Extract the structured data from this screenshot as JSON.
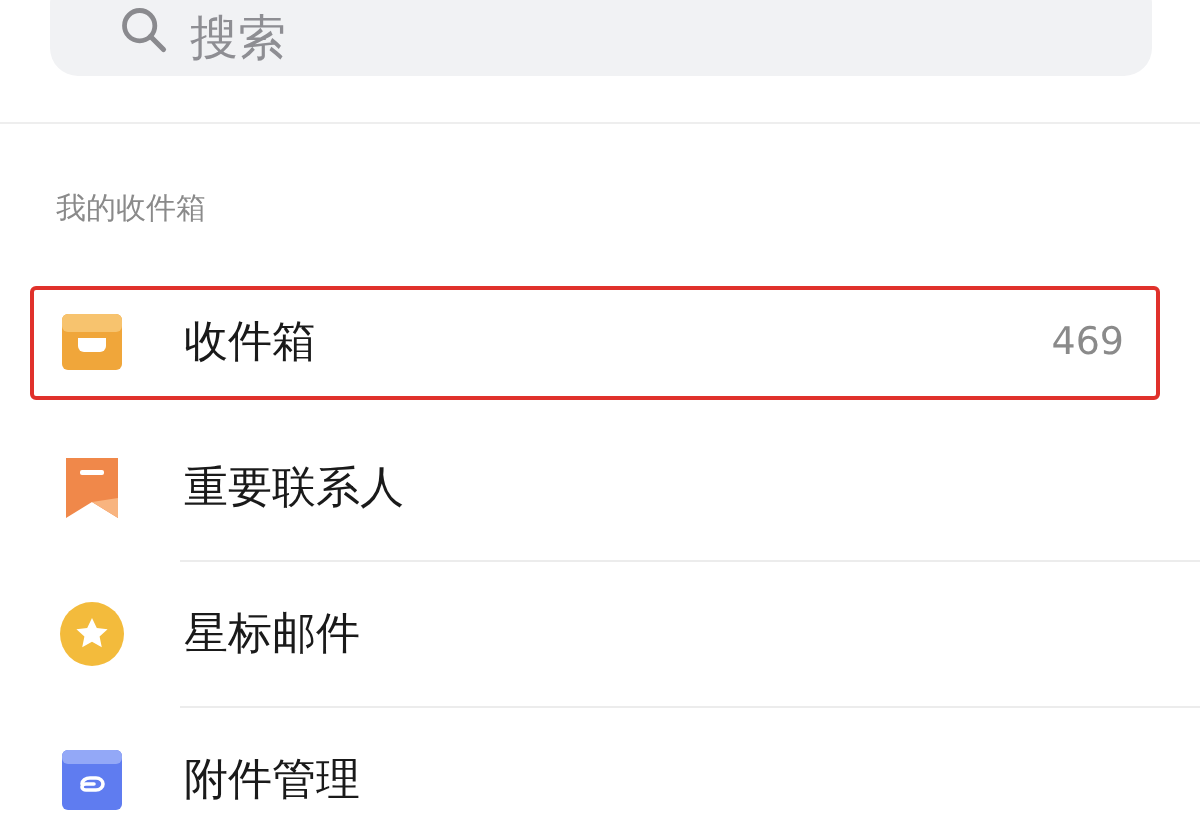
{
  "search": {
    "placeholder": "搜索"
  },
  "section": {
    "title": "我的收件箱"
  },
  "items": [
    {
      "kind": "inbox",
      "label": "收件箱",
      "count": "469",
      "highlighted": true
    },
    {
      "kind": "bookmark",
      "label": "重要联系人",
      "highlighted": false
    },
    {
      "kind": "star",
      "label": "星标邮件",
      "highlighted": false
    },
    {
      "kind": "attachment",
      "label": "附件管理",
      "highlighted": false
    }
  ]
}
